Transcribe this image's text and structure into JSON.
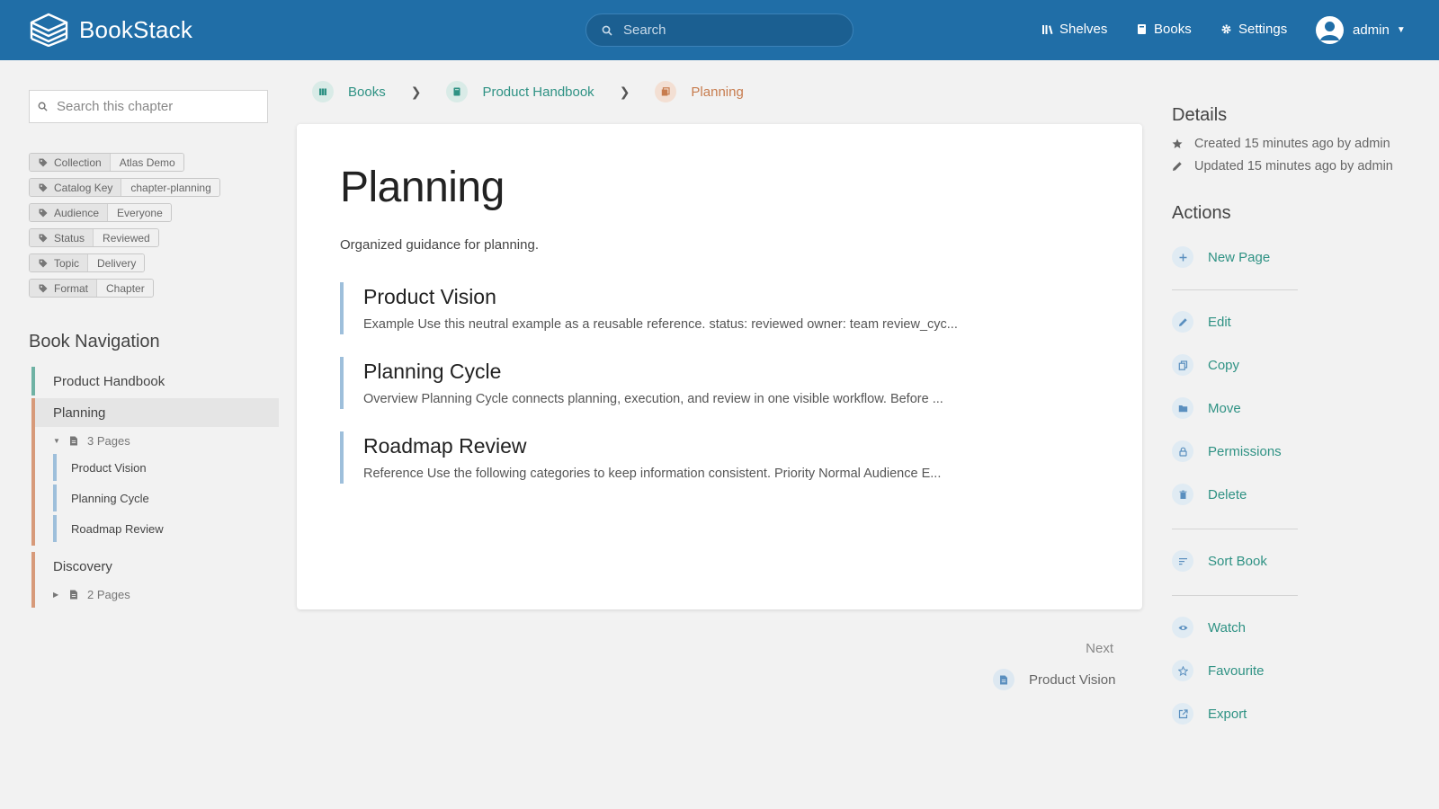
{
  "header": {
    "app_name": "BookStack",
    "search_placeholder": "Search",
    "nav": [
      {
        "label": "Shelves",
        "icon": "shelves-icon"
      },
      {
        "label": "Books",
        "icon": "books-icon"
      },
      {
        "label": "Settings",
        "icon": "gear-icon"
      }
    ],
    "user_name": "admin",
    "brand_color": "#206ea7"
  },
  "left": {
    "search_placeholder": "Search this chapter",
    "tags": [
      {
        "key": "Collection",
        "value": "Atlas Demo"
      },
      {
        "key": "Catalog Key",
        "value": "chapter-planning"
      },
      {
        "key": "Audience",
        "value": "Everyone"
      },
      {
        "key": "Status",
        "value": "Reviewed"
      },
      {
        "key": "Topic",
        "value": "Delivery"
      },
      {
        "key": "Format",
        "value": "Chapter"
      }
    ],
    "book_nav_title": "Book Navigation",
    "book": "Product Handbook",
    "current_chapter": "Planning",
    "current_pages_count": "3 Pages",
    "current_pages": [
      "Product Vision",
      "Planning Cycle",
      "Roadmap Review"
    ],
    "other_chapter": "Discovery",
    "other_pages_count": "2 Pages"
  },
  "breadcrumb": {
    "books": "Books",
    "book": "Product Handbook",
    "chapter": "Planning"
  },
  "main": {
    "title": "Planning",
    "description": "Organized guidance for planning.",
    "pages": [
      {
        "title": "Product Vision",
        "excerpt": "Example Use this neutral example as a reusable reference. status: reviewed owner: team review_cyc..."
      },
      {
        "title": "Planning Cycle",
        "excerpt": "Overview Planning Cycle connects planning, execution, and review in one visible workflow. Before ..."
      },
      {
        "title": "Roadmap Review",
        "excerpt": "Reference Use the following categories to keep information consistent. Priority Normal Audience E..."
      }
    ],
    "next_label": "Next",
    "next_page": "Product Vision"
  },
  "right": {
    "details_title": "Details",
    "created": "Created 15 minutes ago by admin",
    "updated": "Updated 15 minutes ago by admin",
    "actions_title": "Actions",
    "actions": {
      "new_page": "New Page",
      "edit": "Edit",
      "copy": "Copy",
      "move": "Move",
      "permissions": "Permissions",
      "delete": "Delete",
      "sort_book": "Sort Book",
      "watch": "Watch",
      "favourite": "Favourite",
      "export": "Export"
    }
  },
  "colors": {
    "book": "#2f9284",
    "chapter": "#c77c4e",
    "page": "#9ebfdb"
  }
}
